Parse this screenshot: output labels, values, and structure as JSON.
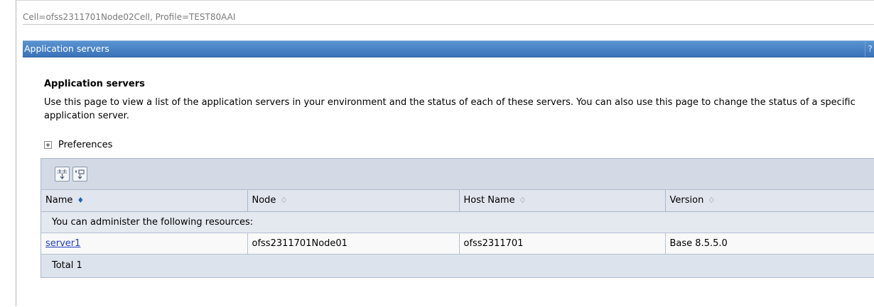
{
  "context": {
    "text": "Cell=ofss2311701Node02Cell, Profile=TEST80AAI"
  },
  "panel": {
    "title": "Application servers",
    "help": "?",
    "help_dash": "-"
  },
  "page": {
    "heading": "Application servers",
    "description": "Use this page to view a list of the application servers in your environment and the status of each of these servers. You can also use this page to change the status of a specific application server.",
    "preferences_label": "Preferences"
  },
  "table": {
    "toolbar": [
      {
        "icon": "show-filter-icon"
      },
      {
        "icon": "select-all-icon"
      }
    ],
    "columns": [
      {
        "label": "Name",
        "sort_glyph": "♦"
      },
      {
        "label": "Node",
        "sort_glyph": "♢"
      },
      {
        "label": "Host Name",
        "sort_glyph": "♢"
      },
      {
        "label": "Version",
        "sort_glyph": "♢"
      }
    ],
    "section_label": "You can administer the following resources:",
    "rows": [
      {
        "name": "server1",
        "node": "ofss2311701Node01",
        "host": "ofss2311701",
        "version": "Base 8.5.5.0"
      }
    ],
    "total": "Total 1"
  },
  "colors": {
    "title_bar": "#3a73b8",
    "table_header": "#e0e5ee",
    "link": "#1f3fbf"
  }
}
